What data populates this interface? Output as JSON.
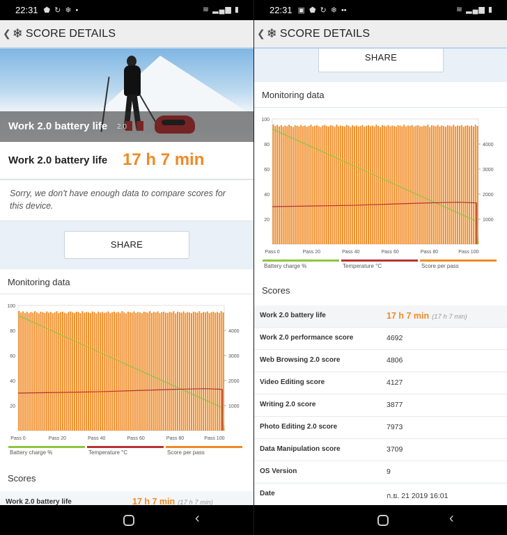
{
  "status_left": {
    "time": "22:31"
  },
  "status_right": {
    "time": "22:31"
  },
  "app": {
    "title": "SCORE DETAILS"
  },
  "hero": {
    "caption": "Work 2.0 battery life",
    "version": "2.0"
  },
  "result": {
    "label": "Work 2.0 battery life",
    "value": "17 h 7 min"
  },
  "compare_note": "Sorry, we don't have enough data to compare scores for this device.",
  "share_label": "SHARE",
  "monitoring_title": "Monitoring data",
  "scores_title": "Scores",
  "chart_data": {
    "type": "line",
    "x_ticks": [
      "Pass 0",
      "Pass 20",
      "Pass 40",
      "Pass 60",
      "Pass 80",
      "Pass 100"
    ],
    "y_left_ticks": [
      "100",
      "80",
      "60",
      "40",
      "20"
    ],
    "y_right_ticks": [
      "4000",
      "3000",
      "2000",
      "1000"
    ],
    "legend": [
      "Battery charge %",
      "Temperature °C",
      "Score per pass"
    ],
    "colors": {
      "battery": "#8cc63f",
      "temperature": "#b83232",
      "score": "#f08a24"
    },
    "battery_x": [
      0,
      103,
      104,
      105
    ],
    "battery_y": [
      92,
      19,
      19,
      0
    ],
    "temperature_x": [
      0,
      20,
      40,
      60,
      80,
      95,
      104
    ],
    "temperature_y": [
      30,
      30.5,
      31,
      32,
      33,
      33.5,
      33
    ],
    "score_passes": 104,
    "score_values": [
      4780,
      4720,
      4760,
      4700,
      4750,
      4690,
      4740,
      4710,
      4770,
      4720,
      4680,
      4750,
      4730,
      4700,
      4760,
      4710,
      4740,
      4690,
      4720,
      4770,
      4700,
      4730,
      4750,
      4710,
      4680,
      4740,
      4760,
      4720,
      4700,
      4750,
      4730,
      4690,
      4770,
      4710,
      4740,
      4720,
      4700,
      4760,
      4730,
      4680,
      4750,
      4710,
      4740,
      4700,
      4720,
      4760,
      4690,
      4730,
      4750,
      4710,
      4740,
      4700,
      4770,
      4720,
      4680,
      4750,
      4730,
      4710,
      4760,
      4700,
      4740,
      4720,
      4690,
      4750,
      4730,
      4710,
      4770,
      4700,
      4740,
      4720,
      4760,
      4690,
      4730,
      4750,
      4710,
      4700,
      4740,
      4720,
      4770,
      4680,
      4750,
      4730,
      4710,
      4760,
      4700,
      4740,
      4720,
      4690,
      4750,
      4730,
      4710,
      4770,
      4700,
      4740,
      4720,
      4760,
      4690,
      4730,
      4750,
      4710,
      4740,
      4700,
      4770,
      4720
    ],
    "ylim_left": [
      0,
      100
    ],
    "ylim_right": [
      0,
      5000
    ],
    "xlim": [
      0,
      105
    ]
  },
  "scores": [
    {
      "name": "Work 2.0 battery life",
      "value": "17 h 7 min",
      "sub": "(17 h 7 min)"
    },
    {
      "name": "Work 2.0 performance score",
      "value": "4692"
    },
    {
      "name": "Web Browsing 2.0 score",
      "value": "4806"
    },
    {
      "name": "Video Editing score",
      "value": "4127"
    },
    {
      "name": "Writing 2.0 score",
      "value": "3877"
    },
    {
      "name": "Photo Editing 2.0 score",
      "value": "7973"
    },
    {
      "name": "Data Manipulation score",
      "value": "3709"
    },
    {
      "name": "OS Version",
      "value": "9"
    },
    {
      "name": "Date",
      "value": "ก.ย. 21 2019 16:01"
    }
  ]
}
